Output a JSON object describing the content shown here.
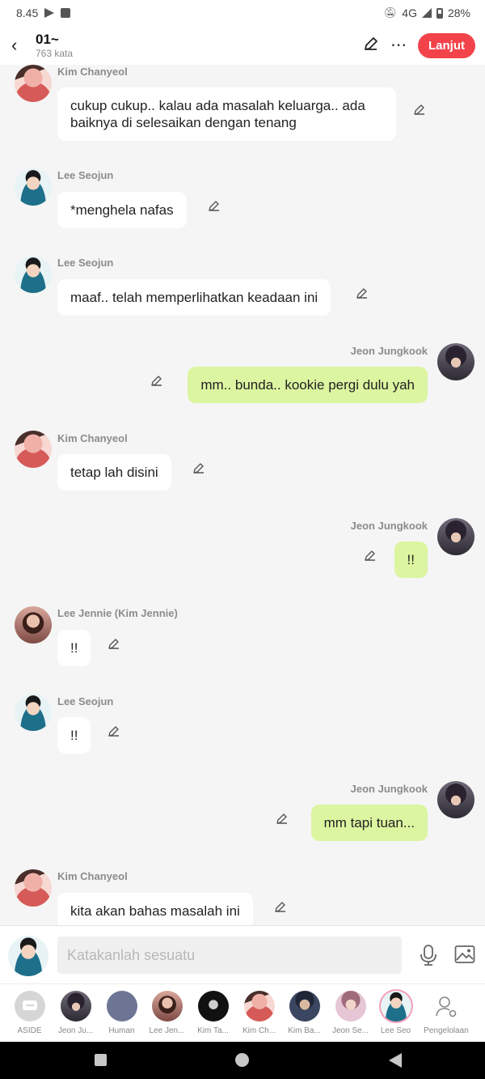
{
  "status_bar": {
    "time": "8.45",
    "network": "4G",
    "battery": "28%"
  },
  "header": {
    "title": "01~",
    "subtitle": "763 kata",
    "next_label": "Lanjut"
  },
  "messages": [
    {
      "name": "Kim Chanyeol",
      "text": "cukup cukup.. kalau ada masalah keluarga.. ada baiknya di selesaikan dengan tenang"
    },
    {
      "name": "Lee Seojun",
      "text": "*menghela nafas"
    },
    {
      "name": "Lee Seojun",
      "text": "maaf.. telah memperlihatkan keadaan ini"
    },
    {
      "name": "Jeon Jungkook",
      "text": "mm.. bunda.. kookie pergi dulu yah"
    },
    {
      "name": "Kim Chanyeol",
      "text": "tetap lah disini"
    },
    {
      "name": "Jeon Jungkook",
      "text": "!!"
    },
    {
      "name": "Lee Jennie (Kim Jennie)",
      "text": "!!"
    },
    {
      "name": "Lee Seojun",
      "text": "!!"
    },
    {
      "name": "Jeon Jungkook",
      "text": "mm tapi tuan..."
    },
    {
      "name": "Kim Chanyeol",
      "text": "kita akan bahas masalah ini"
    }
  ],
  "composer": {
    "placeholder": "Katakanlah sesuatu"
  },
  "characters": [
    {
      "label": "ASIDE"
    },
    {
      "label": "Jeon Ju..."
    },
    {
      "label": "Human"
    },
    {
      "label": "Lee Jen..."
    },
    {
      "label": "Kim Ta..."
    },
    {
      "label": "Kim Ch..."
    },
    {
      "label": "Kim Ba..."
    },
    {
      "label": "Jeon Se..."
    },
    {
      "label": "Lee Seo"
    },
    {
      "label": "Pengelolaan"
    }
  ],
  "colors": {
    "accent": "#f2434a",
    "own_bubble": "#dcf5a0",
    "other_bubble": "#ffffff"
  }
}
